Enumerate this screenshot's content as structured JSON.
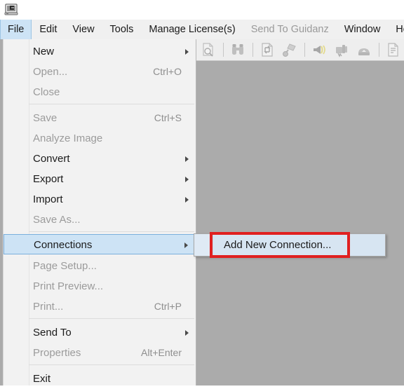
{
  "window": {
    "app_icon": "computer-monitor-icon"
  },
  "menubar": {
    "items": [
      {
        "label": "File",
        "state": "active"
      },
      {
        "label": "Edit",
        "state": "enabled"
      },
      {
        "label": "View",
        "state": "enabled"
      },
      {
        "label": "Tools",
        "state": "enabled"
      },
      {
        "label": "Manage License(s)",
        "state": "enabled"
      },
      {
        "label": "Send To Guidanz",
        "state": "disabled"
      },
      {
        "label": "Window",
        "state": "enabled"
      },
      {
        "label": "He",
        "state": "enabled"
      }
    ]
  },
  "toolbar": {
    "icons": [
      {
        "name": "print-preview-icon",
        "state": "disabled"
      },
      {
        "name": "binoculars-search-icon",
        "state": "disabled"
      },
      {
        "name": "refresh-document-icon",
        "state": "disabled"
      },
      {
        "name": "diagnostic-probe-icon",
        "state": "disabled"
      },
      {
        "name": "horn-alert-icon",
        "state": "disabled"
      },
      {
        "name": "engine-data-icon",
        "state": "disabled"
      },
      {
        "name": "data-upload-icon",
        "state": "disabled"
      },
      {
        "name": "report-document-icon",
        "state": "disabled"
      }
    ]
  },
  "file_menu": {
    "items": [
      {
        "label": "New",
        "accel": "",
        "state": "enabled",
        "submenu": true
      },
      {
        "label": "Open...",
        "accel": "Ctrl+O",
        "state": "disabled",
        "submenu": false
      },
      {
        "label": "Close",
        "accel": "",
        "state": "disabled",
        "submenu": false
      },
      {
        "label": "Save",
        "accel": "Ctrl+S",
        "state": "disabled",
        "submenu": false
      },
      {
        "label": "Analyze Image",
        "accel": "",
        "state": "disabled",
        "submenu": false
      },
      {
        "label": "Convert",
        "accel": "",
        "state": "enabled",
        "submenu": true
      },
      {
        "label": "Export",
        "accel": "",
        "state": "enabled",
        "submenu": true
      },
      {
        "label": "Import",
        "accel": "",
        "state": "enabled",
        "submenu": true
      },
      {
        "label": "Save As...",
        "accel": "",
        "state": "disabled",
        "submenu": false
      },
      {
        "label": "Connections",
        "accel": "",
        "state": "highlighted",
        "submenu": true
      },
      {
        "label": "Page Setup...",
        "accel": "",
        "state": "disabled",
        "submenu": false
      },
      {
        "label": "Print Preview...",
        "accel": "",
        "state": "disabled",
        "submenu": false
      },
      {
        "label": "Print...",
        "accel": "Ctrl+P",
        "state": "disabled",
        "submenu": false
      },
      {
        "label": "Send To",
        "accel": "",
        "state": "enabled",
        "submenu": true
      },
      {
        "label": "Properties",
        "accel": "Alt+Enter",
        "state": "disabled",
        "submenu": false
      },
      {
        "label": "Exit",
        "accel": "",
        "state": "enabled",
        "submenu": false
      }
    ]
  },
  "connections_submenu": {
    "items": [
      {
        "label": "Add New Connection...",
        "state": "enabled"
      }
    ]
  },
  "annotation": {
    "name": "red-highlight-rectangle",
    "color": "#e02020",
    "targets": "Add New Connection..."
  },
  "colors": {
    "menu_background": "#f2f2f2",
    "workspace_background": "#ababab",
    "highlight_fill": "#cde3f5",
    "highlight_border": "#7aafdd",
    "disabled_text": "#9b9b9b",
    "enabled_text": "#1a1a1a",
    "annotation_red": "#e02020"
  }
}
